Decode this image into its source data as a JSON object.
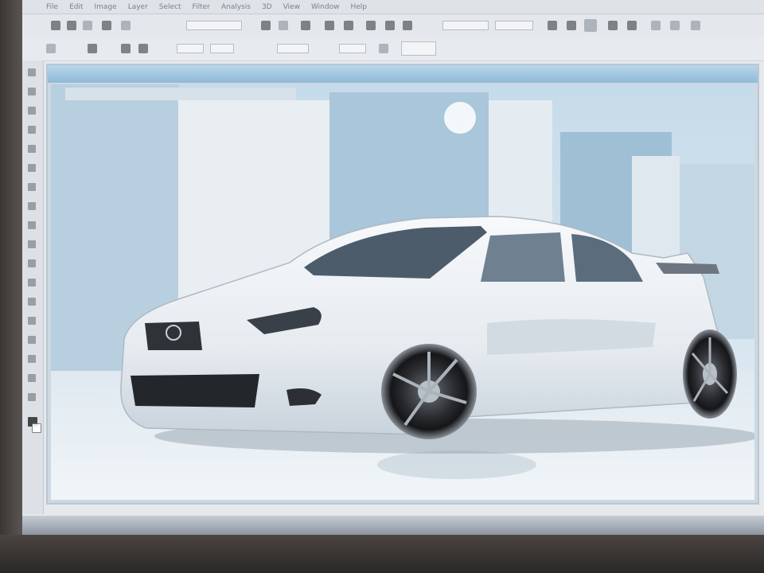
{
  "app": {
    "window_title": "",
    "menu": [
      "File",
      "Edit",
      "Image",
      "Layer",
      "Select",
      "Filter",
      "Analysis",
      "3D",
      "View",
      "Window",
      "Help"
    ]
  },
  "toolbar": {
    "mode_label": "",
    "feather_value": ""
  },
  "document": {
    "title": "",
    "subject": "white tuned car in studio"
  },
  "statusbar": {
    "start_label": "",
    "task_label": ""
  },
  "colors": {
    "screen_bg": "#e6e9ec",
    "canvas_sky": "#cfe0ec",
    "car_body": "#eef1f4"
  }
}
